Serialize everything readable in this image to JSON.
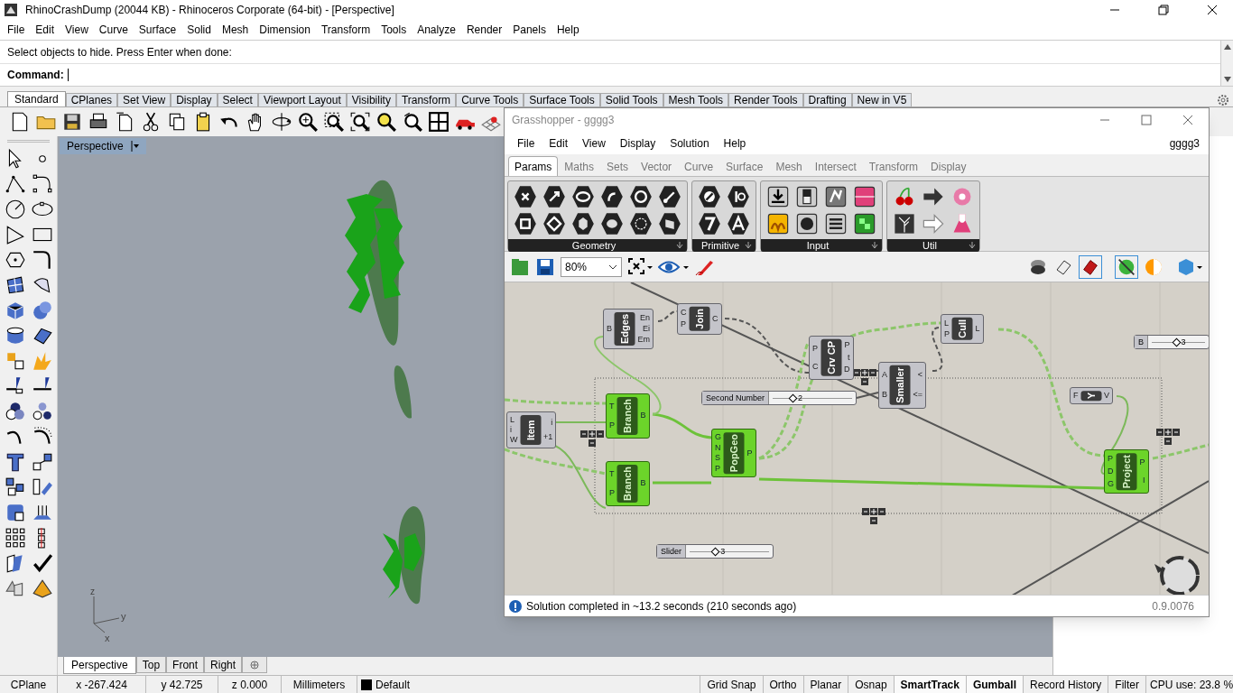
{
  "title_bar": {
    "title": "RhinoCrashDump (20044 KB) - Rhinoceros Corporate (64-bit) - [Perspective]"
  },
  "menu": [
    "File",
    "Edit",
    "View",
    "Curve",
    "Surface",
    "Solid",
    "Mesh",
    "Dimension",
    "Transform",
    "Tools",
    "Analyze",
    "Render",
    "Panels",
    "Help"
  ],
  "command": {
    "history": "Select objects to hide. Press Enter when done:",
    "prompt": "Command:"
  },
  "toolbar_tabs": [
    {
      "label": "Standard",
      "selected": true
    },
    {
      "label": "CPlanes",
      "selected": false
    },
    {
      "label": "Set View",
      "selected": false
    },
    {
      "label": "Display",
      "selected": false
    },
    {
      "label": "Select",
      "selected": false
    },
    {
      "label": "Viewport Layout",
      "selected": false
    },
    {
      "label": "Visibility",
      "selected": false
    },
    {
      "label": "Transform",
      "selected": false
    },
    {
      "label": "Curve Tools",
      "selected": false
    },
    {
      "label": "Surface Tools",
      "selected": false
    },
    {
      "label": "Solid Tools",
      "selected": false
    },
    {
      "label": "Mesh Tools",
      "selected": false
    },
    {
      "label": "Render Tools",
      "selected": false
    },
    {
      "label": "Drafting",
      "selected": false
    },
    {
      "label": "New in V5",
      "selected": false
    }
  ],
  "viewport": {
    "label": "Perspective",
    "axes": [
      "z",
      "y",
      "x"
    ]
  },
  "viewport_tabs": [
    {
      "label": "Perspective",
      "selected": true
    },
    {
      "label": "Top",
      "selected": false
    },
    {
      "label": "Front",
      "selected": false
    },
    {
      "label": "Right",
      "selected": false
    }
  ],
  "status_bar": [
    {
      "kind": "readout",
      "text": "CPlane"
    },
    {
      "kind": "readout",
      "text": "x -267.424"
    },
    {
      "kind": "readout",
      "text": "y 42.725"
    },
    {
      "kind": "readout",
      "text": "z 0.000"
    },
    {
      "kind": "readout",
      "text": "Millimeters"
    },
    {
      "kind": "layer",
      "text": "Default"
    },
    {
      "kind": "toggle",
      "text": "Grid Snap",
      "on": false
    },
    {
      "kind": "toggle",
      "text": "Ortho",
      "on": false
    },
    {
      "kind": "toggle",
      "text": "Planar",
      "on": false
    },
    {
      "kind": "toggle",
      "text": "Osnap",
      "on": false
    },
    {
      "kind": "toggle",
      "text": "SmartTrack",
      "on": true
    },
    {
      "kind": "toggle",
      "text": "Gumball",
      "on": true
    },
    {
      "kind": "toggle",
      "text": "Record History",
      "on": false
    },
    {
      "kind": "toggle",
      "text": "Filter",
      "on": false
    },
    {
      "kind": "readout",
      "text": "CPU use: 23.8 %"
    }
  ],
  "grasshopper": {
    "title": "Grasshopper - gggg3",
    "menu": [
      "File",
      "Edit",
      "View",
      "Display",
      "Solution",
      "Help"
    ],
    "document": "gggg3",
    "tabs": [
      {
        "label": "Params",
        "selected": true
      },
      {
        "label": "Maths",
        "selected": false
      },
      {
        "label": "Sets",
        "selected": false
      },
      {
        "label": "Vector",
        "selected": false
      },
      {
        "label": "Curve",
        "selected": false
      },
      {
        "label": "Surface",
        "selected": false
      },
      {
        "label": "Mesh",
        "selected": false
      },
      {
        "label": "Intersect",
        "selected": false
      },
      {
        "label": "Transform",
        "selected": false
      },
      {
        "label": "Display",
        "selected": false
      }
    ],
    "panels": [
      {
        "label": "Geometry"
      },
      {
        "label": "Primitive"
      },
      {
        "label": "Input"
      },
      {
        "label": "Util"
      }
    ],
    "zoom": "80%",
    "nodes": [
      {
        "kind": "component",
        "name": "Edges",
        "inputs": [
          "B"
        ],
        "outputs": [
          "En",
          "Ei",
          "Em"
        ],
        "selected": false
      },
      {
        "kind": "component",
        "name": "Join",
        "inputs": [
          "C",
          "P"
        ],
        "outputs": [
          "C"
        ],
        "selected": false
      },
      {
        "kind": "component",
        "name": "Crv CP",
        "inputs": [
          "P",
          "C"
        ],
        "outputs": [
          "P",
          "t",
          "D"
        ],
        "selected": false
      },
      {
        "kind": "component",
        "name": "Cull",
        "inputs": [
          "L",
          "P"
        ],
        "outputs": [
          "L"
        ],
        "selected": false
      },
      {
        "kind": "component",
        "name": "Smaller",
        "inputs": [
          "A",
          "B"
        ],
        "outputs": [
          "<",
          "<="
        ],
        "selected": false
      },
      {
        "kind": "slider",
        "name": "B",
        "value": "3",
        "level": 0.45,
        "selected": false
      },
      {
        "kind": "slider",
        "name": "Second Number",
        "value": "2",
        "level": 0.25,
        "selected": false
      },
      {
        "kind": "component",
        "name": "Y",
        "inputs": [
          "F"
        ],
        "outputs": [
          "V"
        ],
        "selected": false
      },
      {
        "kind": "component",
        "name": "Item",
        "inputs": [
          "L",
          "i",
          "W"
        ],
        "outputs": [
          "i",
          "+1"
        ],
        "selected": false
      },
      {
        "kind": "component",
        "name": "Branch",
        "inputs": [
          "T",
          "P"
        ],
        "outputs": [
          "B"
        ],
        "selected": true
      },
      {
        "kind": "component",
        "name": "Branch",
        "inputs": [
          "T",
          "P"
        ],
        "outputs": [
          "B"
        ],
        "selected": true
      },
      {
        "kind": "component",
        "name": "PopGeo",
        "inputs": [
          "G",
          "N",
          "S",
          "P"
        ],
        "outputs": [
          "P"
        ],
        "selected": true
      },
      {
        "kind": "component",
        "name": "Project",
        "inputs": [
          "P",
          "D",
          "G"
        ],
        "outputs": [
          "P",
          "I"
        ],
        "selected": true
      },
      {
        "kind": "slider",
        "name": "Slider",
        "value": "3",
        "level": 0.32,
        "selected": false
      }
    ],
    "status": "Solution completed in ~13.2 seconds (210 seconds ago)",
    "version": "0.9.0076"
  }
}
